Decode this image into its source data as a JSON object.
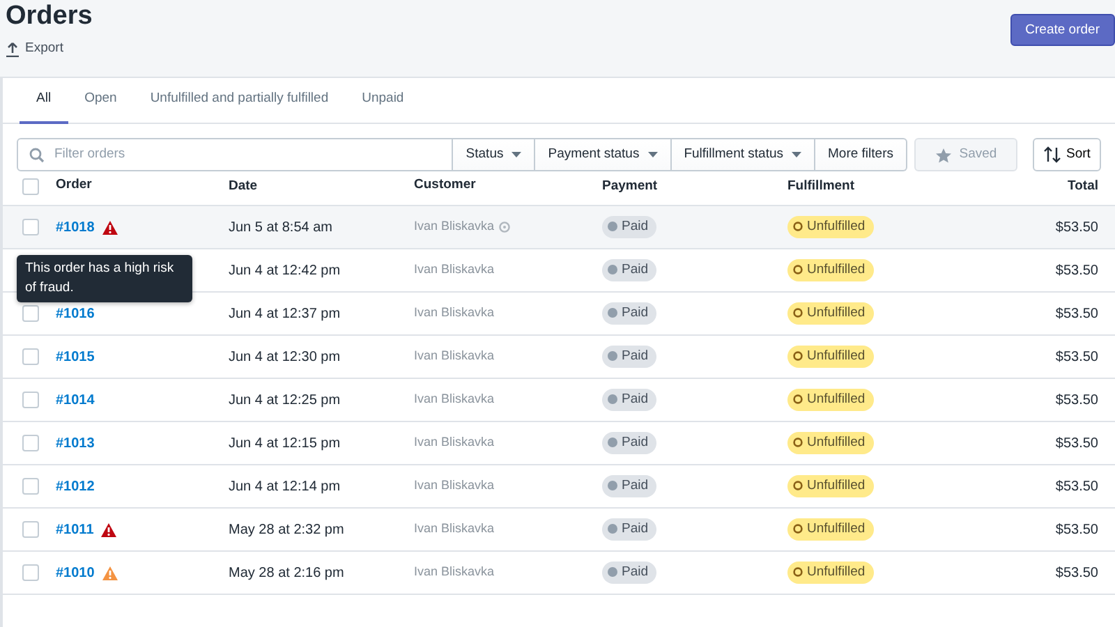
{
  "page": {
    "title": "Orders",
    "export_label": "Export",
    "primary_action": "Create order"
  },
  "tabs": [
    {
      "label": "All",
      "selected": true
    },
    {
      "label": "Open",
      "selected": false
    },
    {
      "label": "Unfulfilled and partially fulfilled",
      "selected": false
    },
    {
      "label": "Unpaid",
      "selected": false
    }
  ],
  "filters": {
    "search_placeholder": "Filter orders",
    "dropdowns": [
      "Status",
      "Payment status",
      "Fulfillment status"
    ],
    "more_filters": "More filters",
    "saved": {
      "label": "Saved",
      "disabled": true
    },
    "sort": "Sort"
  },
  "table": {
    "columns": [
      "Order",
      "Date",
      "Customer",
      "Payment",
      "Fulfillment",
      "Total"
    ],
    "select_all_checked": false,
    "rows": [
      {
        "order": "#1018",
        "color": "#bf0711",
        "highlighted": true,
        "date": "Jun 5 at 8:54 am",
        "customer": "Ivan Bliskavka",
        "customer_info": true,
        "payment": "Paid",
        "fulfillment": "Unfulfilled",
        "total": "$53.50",
        "checked": false
      },
      {
        "highlighted": false,
        "date": "Jun 4 at 12:42 pm",
        "customer": "Ivan Bliskavka",
        "customer_info": false,
        "payment": "Paid",
        "fulfillment": "Unfulfilled",
        "total": "$53.50"
      },
      {
        "order": "#1016",
        "highlighted": false,
        "date": "Jun 4 at 12:37 pm",
        "customer": "Ivan Bliskavka",
        "customer_info": false,
        "payment": "Paid",
        "fulfillment": "Unfulfilled",
        "total": "$53.50",
        "checked": false
      },
      {
        "order": "#1015",
        "highlighted": false,
        "date": "Jun 4 at 12:30 pm",
        "customer": "Ivan Bliskavka",
        "customer_info": false,
        "payment": "Paid",
        "fulfillment": "Unfulfilled",
        "total": "$53.50",
        "checked": false
      },
      {
        "order": "#1014",
        "highlighted": false,
        "date": "Jun 4 at 12:25 pm",
        "customer": "Ivan Bliskavka",
        "customer_info": false,
        "payment": "Paid",
        "fulfillment": "Unfulfilled",
        "total": "$53.50",
        "checked": false
      },
      {
        "order": "#1013",
        "highlighted": false,
        "date": "Jun 4 at 12:15 pm",
        "customer": "Ivan Bliskavka",
        "customer_info": false,
        "payment": "Paid",
        "fulfillment": "Unfulfilled",
        "total": "$53.50",
        "checked": false
      },
      {
        "order": "#1012",
        "highlighted": false,
        "date": "Jun 4 at 12:14 pm",
        "customer": "Ivan Bliskavka",
        "customer_info": false,
        "payment": "Paid",
        "fulfillment": "Unfulfilled",
        "total": "$53.50",
        "checked": false
      },
      {
        "order": "#1011",
        "color": "#bf0711",
        "highlighted": false,
        "date": "May 28 at 2:32 pm",
        "customer": "Ivan Bliskavka",
        "customer_info": false,
        "payment": "Paid",
        "fulfillment": "Unfulfilled",
        "total": "$53.50",
        "checked": false
      },
      {
        "order": "#1010",
        "color": "#f49342",
        "highlighted": false,
        "date": "May 28 at 2:16 pm",
        "customer": "Ivan Bliskavka",
        "customer_info": false,
        "payment": "Paid",
        "fulfillment": "Unfulfilled",
        "total": "$53.50",
        "checked": false
      }
    ]
  },
  "tooltip": {
    "text": "This order has a high risk of fraud."
  }
}
